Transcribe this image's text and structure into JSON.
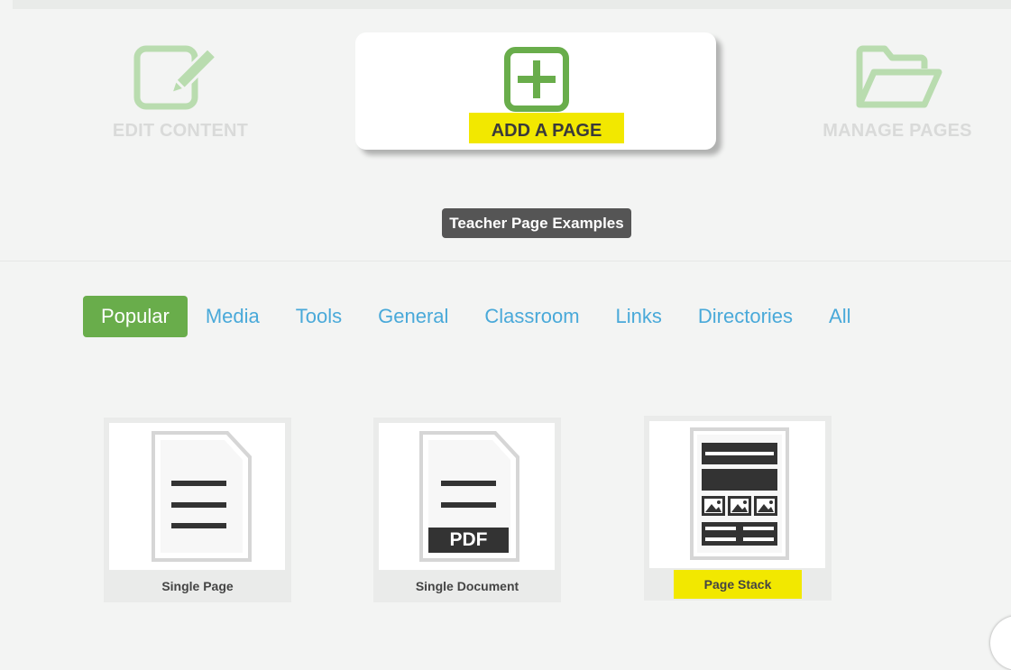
{
  "actions": {
    "edit": {
      "label": "EDIT CONTENT",
      "icon": "edit-icon"
    },
    "add": {
      "label": "ADD A PAGE",
      "icon": "plus-box-icon"
    },
    "manage": {
      "label": "MANAGE PAGES",
      "icon": "folder-open-icon"
    }
  },
  "tooltip": "Teacher Page Examples",
  "tabs": [
    {
      "label": "Popular",
      "active": true
    },
    {
      "label": "Media"
    },
    {
      "label": "Tools"
    },
    {
      "label": "General"
    },
    {
      "label": "Classroom"
    },
    {
      "label": "Links"
    },
    {
      "label": "Directories"
    },
    {
      "label": "All"
    }
  ],
  "cards": [
    {
      "title": "Single Page",
      "icon": "single-page-icon"
    },
    {
      "title": "Single Document",
      "icon": "pdf-document-icon",
      "badge": "PDF"
    },
    {
      "title": "Page Stack",
      "icon": "page-stack-icon",
      "highlighted": true
    }
  ],
  "colors": {
    "accent_green": "#69ad4b",
    "icon_green": "#a9d39a",
    "tab_blue": "#49a9d9",
    "highlight_yellow": "#f2e800",
    "tooltip_gray": "#555555"
  }
}
